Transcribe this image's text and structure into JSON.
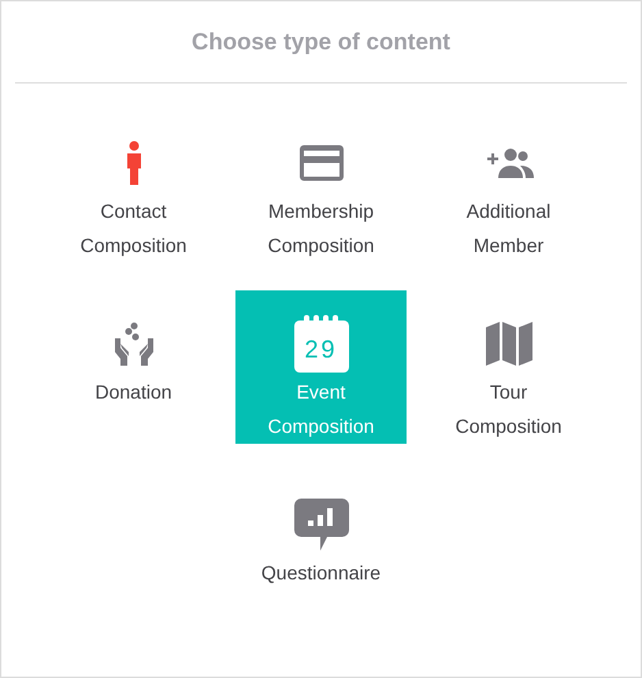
{
  "title": "Choose type of content",
  "items": [
    {
      "kind": "person",
      "label": "Contact Composition",
      "selected": false,
      "color": "#f44336"
    },
    {
      "kind": "card",
      "label": "Membership Composition",
      "selected": false,
      "color": "#7b7a80"
    },
    {
      "kind": "add-people",
      "label": "Additional Member",
      "selected": false,
      "color": "#7b7a80"
    },
    {
      "kind": "donation",
      "label": "Donation",
      "selected": false,
      "color": "#7b7a80"
    },
    {
      "kind": "calendar",
      "label": "Event Composition",
      "selected": true,
      "color": "#04bfb3",
      "icon_text": "29"
    },
    {
      "kind": "map",
      "label": "Tour Composition",
      "selected": false,
      "color": "#7b7a80"
    },
    {
      "kind": "chart-bubble",
      "label": "Questionnaire",
      "selected": false,
      "color": "#7b7a80"
    }
  ]
}
